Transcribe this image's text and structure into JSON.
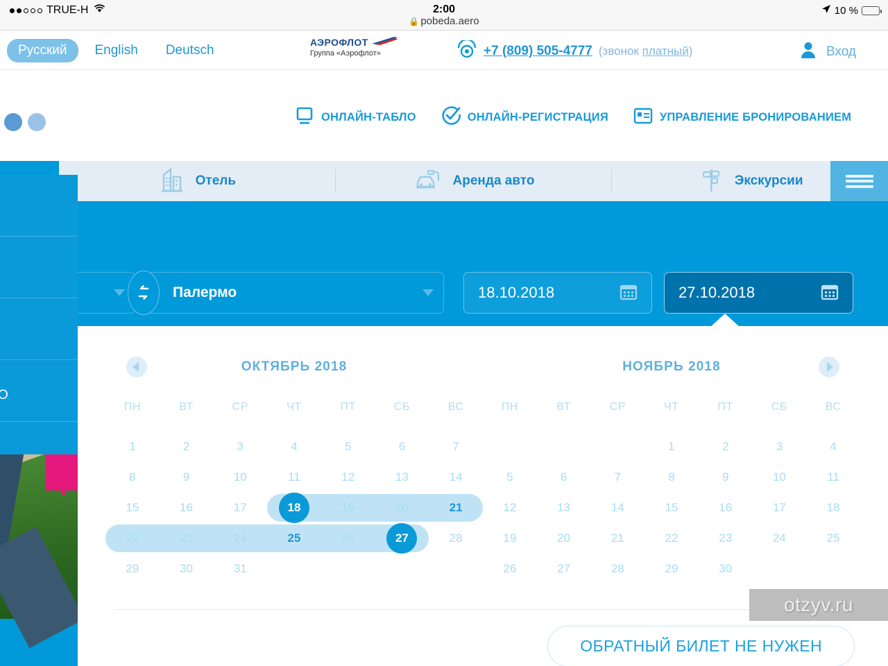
{
  "statusbar": {
    "carrier": "TRUE-H",
    "time": "2:00",
    "battery_pct": "10 %",
    "url": "pobeda.aero",
    "lock_icon": "lock-icon",
    "wifi_icon": "wifi-icon",
    "location_icon": "location-arrow-icon"
  },
  "header": {
    "languages": [
      {
        "label": "Русский",
        "active": true
      },
      {
        "label": "English",
        "active": false
      },
      {
        "label": "Deutsch",
        "active": false
      }
    ],
    "logo": {
      "word": "АЭРОФЛОТ",
      "sub": "Группа «Аэрофлот»"
    },
    "phone": {
      "number": "+7 (809) 505-4777",
      "note_prefix": "(звонок ",
      "note_link": "платный",
      "note_suffix": ")"
    },
    "login": {
      "label": "Вход",
      "icon": "user-icon"
    }
  },
  "service_nav": [
    {
      "label": "ОНЛАЙН-ТАБЛО",
      "icon": "monitor-icon"
    },
    {
      "label": "ОНЛАЙН-РЕГИСТРАЦИЯ",
      "icon": "check-circle-icon"
    },
    {
      "label": "УПРАВЛЕНИЕ БРОНИРОВАНИЕМ",
      "icon": "card-list-icon"
    }
  ],
  "tabs": [
    {
      "label": "Отель",
      "icon": "hotel-icon"
    },
    {
      "label": "Аренда авто",
      "icon": "car-icon"
    },
    {
      "label": "Экскурсии",
      "icon": "signpost-icon"
    }
  ],
  "menu_button": {
    "icon": "hamburger-icon"
  },
  "search": {
    "origin_value": "",
    "swap_icon": "swap-arrows-icon",
    "destination_value": "Палермо",
    "date_out": "18.10.2018",
    "date_back": "27.10.2018",
    "calendar_icon": "calendar-icon"
  },
  "suggestions": {
    "visible_text": "ЕРМО",
    "rows": 5
  },
  "calendar": {
    "prev_icon": "chevron-left-icon",
    "next_icon": "chevron-right-icon",
    "weekdays": [
      "ПН",
      "ВТ",
      "СР",
      "ЧТ",
      "ПТ",
      "СБ",
      "ВС"
    ],
    "months": [
      {
        "title": "ОКТЯБРЬ 2018",
        "weeks": [
          [
            {
              "d": "1",
              "state": "dim"
            },
            {
              "d": "2",
              "state": "dim"
            },
            {
              "d": "3",
              "state": "dim"
            },
            {
              "d": "4",
              "state": "dim"
            },
            {
              "d": "5",
              "state": "dim"
            },
            {
              "d": "6",
              "state": "dim"
            },
            {
              "d": "7",
              "state": "dim"
            }
          ],
          [
            {
              "d": "8",
              "state": "dim"
            },
            {
              "d": "9",
              "state": "dim"
            },
            {
              "d": "10",
              "state": "dim"
            },
            {
              "d": "11",
              "state": "dim"
            },
            {
              "d": "12",
              "state": "dim"
            },
            {
              "d": "13",
              "state": "dim"
            },
            {
              "d": "14",
              "state": "dim"
            }
          ],
          [
            {
              "d": "15",
              "state": "dim"
            },
            {
              "d": "16",
              "state": "dim"
            },
            {
              "d": "17",
              "state": "dim"
            },
            {
              "d": "18",
              "state": "sel",
              "band": "start"
            },
            {
              "d": "19",
              "state": "dim",
              "band": "mid"
            },
            {
              "d": "20",
              "state": "dim",
              "band": "mid"
            },
            {
              "d": "21",
              "state": "avail",
              "band": "end"
            }
          ],
          [
            {
              "d": "22",
              "state": "dim",
              "band": "start"
            },
            {
              "d": "23",
              "state": "dim",
              "band": "mid"
            },
            {
              "d": "24",
              "state": "dim",
              "band": "mid"
            },
            {
              "d": "25",
              "state": "avail",
              "band": "mid"
            },
            {
              "d": "26",
              "state": "dim",
              "band": "mid"
            },
            {
              "d": "27",
              "state": "sel",
              "band": "end"
            },
            {
              "d": "28",
              "state": "dim"
            }
          ],
          [
            {
              "d": "29",
              "state": "dim"
            },
            {
              "d": "30",
              "state": "dim"
            },
            {
              "d": "31",
              "state": "dim"
            },
            {
              "d": "",
              "state": "empty"
            },
            {
              "d": "",
              "state": "empty"
            },
            {
              "d": "",
              "state": "empty"
            },
            {
              "d": "",
              "state": "empty"
            }
          ]
        ]
      },
      {
        "title": "НОЯБРЬ 2018",
        "weeks": [
          [
            {
              "d": "",
              "state": "empty"
            },
            {
              "d": "",
              "state": "empty"
            },
            {
              "d": "",
              "state": "empty"
            },
            {
              "d": "1",
              "state": "dim"
            },
            {
              "d": "2",
              "state": "dim"
            },
            {
              "d": "3",
              "state": "dim"
            },
            {
              "d": "4",
              "state": "dim"
            }
          ],
          [
            {
              "d": "5",
              "state": "dim"
            },
            {
              "d": "6",
              "state": "dim"
            },
            {
              "d": "7",
              "state": "dim"
            },
            {
              "d": "8",
              "state": "dim"
            },
            {
              "d": "9",
              "state": "dim"
            },
            {
              "d": "10",
              "state": "dim"
            },
            {
              "d": "11",
              "state": "dim"
            }
          ],
          [
            {
              "d": "12",
              "state": "dim"
            },
            {
              "d": "13",
              "state": "dim"
            },
            {
              "d": "14",
              "state": "dim"
            },
            {
              "d": "15",
              "state": "dim"
            },
            {
              "d": "16",
              "state": "dim"
            },
            {
              "d": "17",
              "state": "dim"
            },
            {
              "d": "18",
              "state": "dim"
            }
          ],
          [
            {
              "d": "19",
              "state": "dim"
            },
            {
              "d": "20",
              "state": "dim"
            },
            {
              "d": "21",
              "state": "dim"
            },
            {
              "d": "22",
              "state": "dim"
            },
            {
              "d": "23",
              "state": "dim"
            },
            {
              "d": "24",
              "state": "dim"
            },
            {
              "d": "25",
              "state": "dim"
            }
          ],
          [
            {
              "d": "26",
              "state": "dim"
            },
            {
              "d": "27",
              "state": "dim"
            },
            {
              "d": "28",
              "state": "dim"
            },
            {
              "d": "29",
              "state": "dim"
            },
            {
              "d": "30",
              "state": "dim"
            },
            {
              "d": "",
              "state": "empty"
            },
            {
              "d": "",
              "state": "empty"
            }
          ]
        ]
      }
    ],
    "no_return_label": "ОБРАТНЫЙ БИЛЕТ НЕ НУЖЕН"
  },
  "watermark": {
    "text": "otzyv.ru"
  },
  "colors": {
    "brand_blue": "#0099da",
    "dark_blue": "#0072ab",
    "pale_blue": "#e4edf5",
    "accent_text": "#1a9ad8",
    "selected_day": "#0a9ad8",
    "range_band": "#bfe3f5",
    "battery_red": "#ff3b30"
  }
}
